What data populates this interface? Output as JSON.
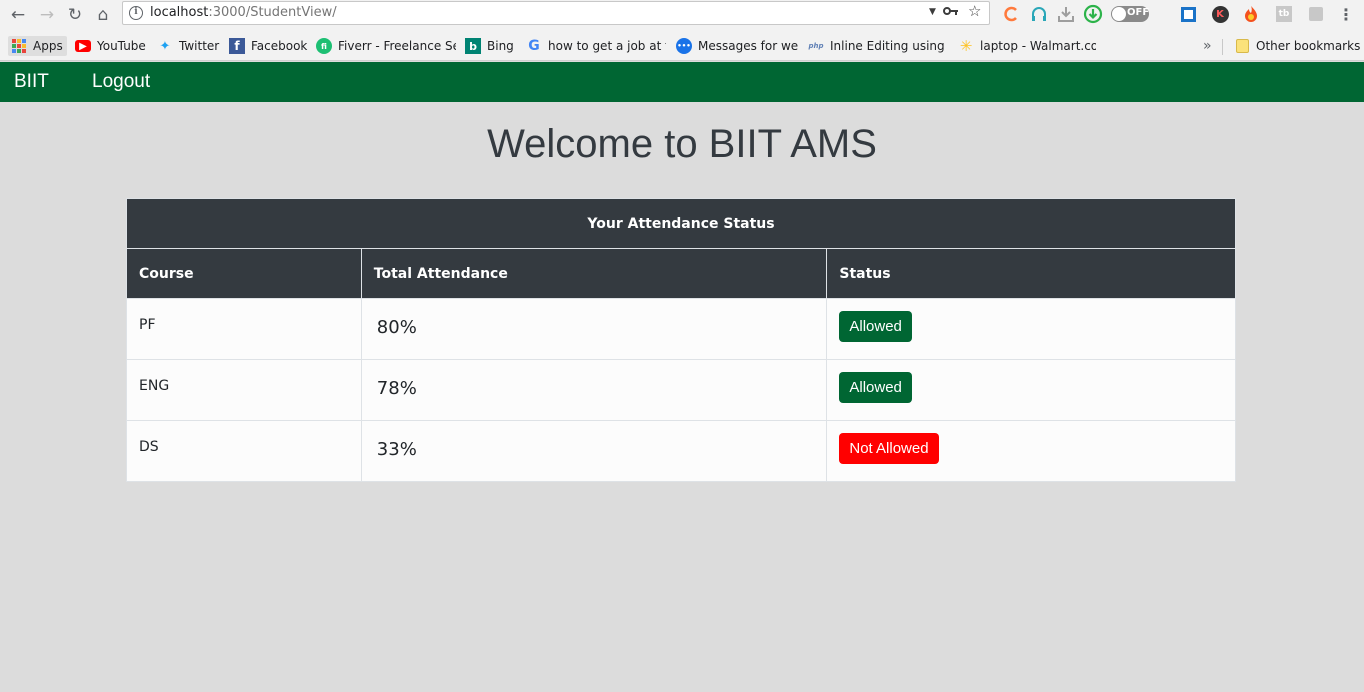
{
  "browser": {
    "url_host": "localhost",
    "url_path": ":3000/StudentView/",
    "toggle_label": "OFF",
    "bookmarks": [
      {
        "label": "Apps",
        "icon": "apps-icon",
        "color": "#e8453c"
      },
      {
        "label": "YouTube",
        "icon": "youtube-icon",
        "color": "#ff0000"
      },
      {
        "label": "Twitter",
        "icon": "twitter-icon",
        "color": "#1da1f2"
      },
      {
        "label": "Facebook",
        "icon": "facebook-icon",
        "color": "#3b5998"
      },
      {
        "label": "Fiverr - Freelance Ser",
        "icon": "fiverr-icon",
        "color": "#1dbf73"
      },
      {
        "label": "Bing",
        "icon": "bing-icon",
        "color": "#008373"
      },
      {
        "label": "how to get a job at fa",
        "icon": "google-icon",
        "color": "#4285f4"
      },
      {
        "label": "Messages for web",
        "icon": "messages-icon",
        "color": "#1a73e8"
      },
      {
        "label": "Inline Editing using P",
        "icon": "php-icon",
        "color": "#6181b6"
      },
      {
        "label": "laptop - Walmart.com",
        "icon": "walmart-icon",
        "color": "#ffc220"
      }
    ],
    "more_label": "»",
    "other_bookmarks": "Other bookmarks"
  },
  "app": {
    "brand": "BIIT",
    "logout": "Logout",
    "welcome": "Welcome to BIIT AMS",
    "table": {
      "caption": "Your Attendance Status",
      "headers": {
        "course": "Course",
        "attendance": "Total Attendance",
        "status": "Status"
      },
      "rows": [
        {
          "course": "PF",
          "attendance": "80%",
          "status": "Allowed",
          "status_color": "#006633"
        },
        {
          "course": "ENG",
          "attendance": "78%",
          "status": "Allowed",
          "status_color": "#006633"
        },
        {
          "course": "DS",
          "attendance": "33%",
          "status": "Not Allowed",
          "status_color": "#ff0000"
        }
      ]
    }
  },
  "colors": {
    "nav_green": "#006633",
    "table_header": "#343a40",
    "page_bg": "#dcdcdc"
  }
}
